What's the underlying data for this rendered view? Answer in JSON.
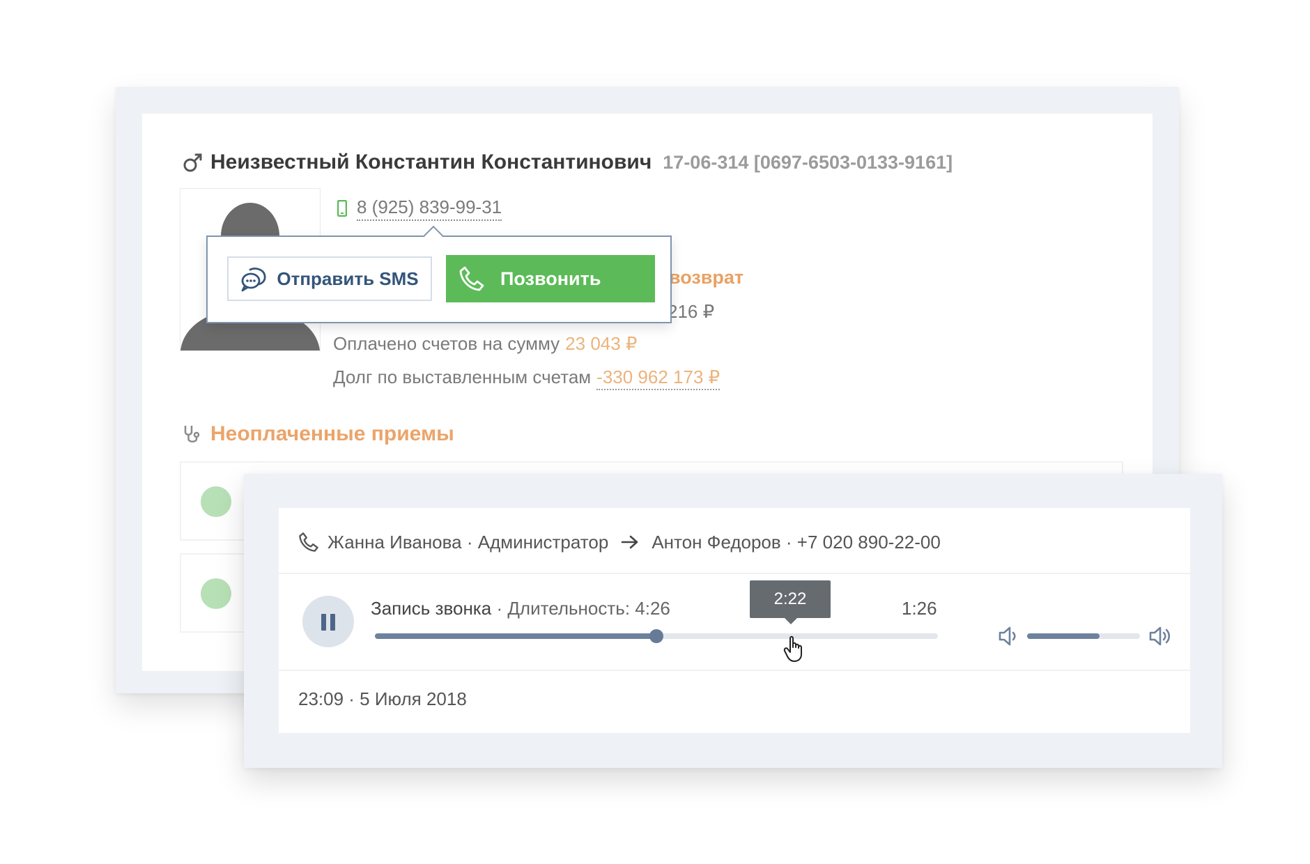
{
  "patient": {
    "name": "Неизвестный Константин Константинович",
    "id_text": "17-06-314 [0697-6503-0133-9161]",
    "phone": "8 (925) 839-99-31",
    "partial_label": "возврат",
    "partial_amount": "216 ₽",
    "paid_label": "Оплачено счетов на сумму",
    "paid_amount": "23 043 ₽",
    "debt_label": "Долг по выставленным счетам",
    "debt_amount": "-330 962 173 ₽"
  },
  "unpaid_section": {
    "title": "Неоплаченные приемы"
  },
  "popup": {
    "sms_label": "Отправить SMS",
    "call_label": "Позвонить"
  },
  "call": {
    "caller": "Жанна Иванова · Администратор",
    "callee": "Антон Федоров · +7 020 890-22-00",
    "record_title": "Запись звонка",
    "duration_text": "· Длительность: 4:26",
    "hover_time": "2:22",
    "remaining_time": "1:26",
    "played_fraction": 0.5,
    "volume_fraction": 0.64,
    "datetime": "23:09 · 5 Июля 2018"
  },
  "colors": {
    "accent_green": "#5cbb58",
    "accent_orange": "#eba46a",
    "slider": "#6d829c"
  }
}
